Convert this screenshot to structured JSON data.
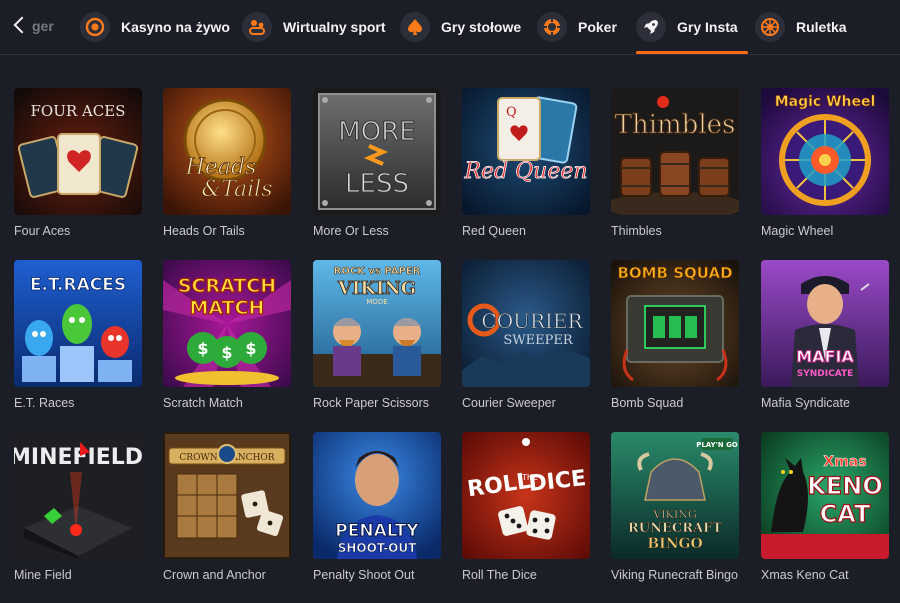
{
  "nav": {
    "prev_label": "‹",
    "partial_label": "ger",
    "items": [
      {
        "label": "Kasyno na żywo",
        "icon": "live-casino-icon",
        "active": false
      },
      {
        "label": "Wirtualny sport",
        "icon": "virtual-sport-icon",
        "active": false
      },
      {
        "label": "Gry stołowe",
        "icon": "spade-icon",
        "active": false
      },
      {
        "label": "Poker",
        "icon": "poker-chip-icon",
        "active": false
      },
      {
        "label": "Gry Insta",
        "icon": "rocket-icon",
        "active": true
      },
      {
        "label": "Ruletka",
        "icon": "roulette-icon",
        "active": false
      }
    ],
    "accent": "#ff6b14"
  },
  "games": [
    {
      "name": "Four Aces",
      "art_text": "FOUR ACES"
    },
    {
      "name": "Heads Or Tails",
      "art_text": "Heads & Tails"
    },
    {
      "name": "More Or Less",
      "art_text": "MORE LESS"
    },
    {
      "name": "Red Queen",
      "art_text": "Red Queen"
    },
    {
      "name": "Thimbles",
      "art_text": "Thimbles"
    },
    {
      "name": "Magic Wheel",
      "art_text": "Magic Wheel"
    },
    {
      "name": "E.T. Races",
      "art_text": "E.T. RACES"
    },
    {
      "name": "Scratch Match",
      "art_text": "SCRATCH MATCH"
    },
    {
      "name": "Rock Paper Scissors",
      "art_text": "ROCK vs PAPER VIKING MODE"
    },
    {
      "name": "Courier Sweeper",
      "art_text": "COURIER SWEEPER"
    },
    {
      "name": "Bomb Squad",
      "art_text": "BOMB SQUAD"
    },
    {
      "name": "Mafia Syndicate",
      "art_text": "MAFIA SYNDICATE"
    },
    {
      "name": "Mine Field",
      "art_text": "MINEFIELD"
    },
    {
      "name": "Crown and Anchor",
      "art_text": "CROWN & ANCHOR"
    },
    {
      "name": "Penalty Shoot Out",
      "art_text": "PENALTY SHOOT-OUT"
    },
    {
      "name": "Roll The Dice",
      "art_text": "ROLL THE DICE"
    },
    {
      "name": "Viking Runecraft Bingo",
      "art_text": "VIKING RUNECRAFT BINGO"
    },
    {
      "name": "Xmas Keno Cat",
      "art_text": "Xmas KENO CAT"
    }
  ],
  "colors": {
    "background": "#1b1e27",
    "nav_icon_bg": "#2c2f39",
    "caption": "#c9cbd0"
  }
}
